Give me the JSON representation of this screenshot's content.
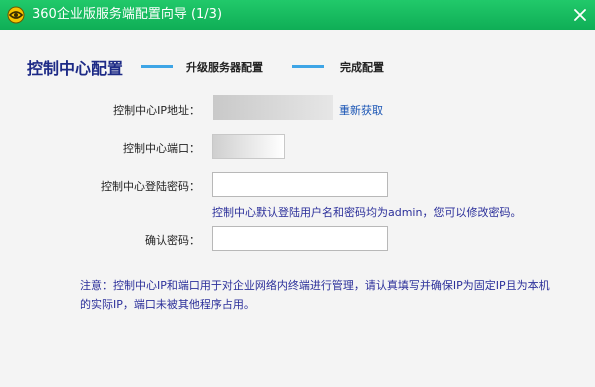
{
  "window": {
    "title": "360企业版服务端配置向导 (1/3)"
  },
  "steps": [
    {
      "label": "控制中心配置",
      "state": "active"
    },
    {
      "label": "升级服务器配置",
      "state": "pending"
    },
    {
      "label": "完成配置",
      "state": "pending"
    }
  ],
  "form": {
    "ip_label": "控制中心IP地址：",
    "ip_value": "",
    "refresh_link": "重新获取",
    "port_label": "控制中心端口：",
    "port_value": "",
    "password_label": "控制中心登陆密码：",
    "password_value": "",
    "password_hint": "控制中心默认登陆用户名和密码均为admin，您可以修改密码。",
    "confirm_label": "确认密码：",
    "confirm_value": ""
  },
  "note": "注意：控制中心IP和端口用于对企业网络内终端进行管理，请认真填写并确保IP为固定IP且为本机的实际IP，端口未被其他程序占用。",
  "colors": {
    "titlebar": "#14b85c",
    "active_step": "#1d2a86",
    "step_line": "#3ea5e6",
    "hint_text": "#2b2f9a",
    "link": "#1a55b5"
  },
  "icons": {
    "app": "360-logo-icon",
    "close": "close-icon"
  }
}
